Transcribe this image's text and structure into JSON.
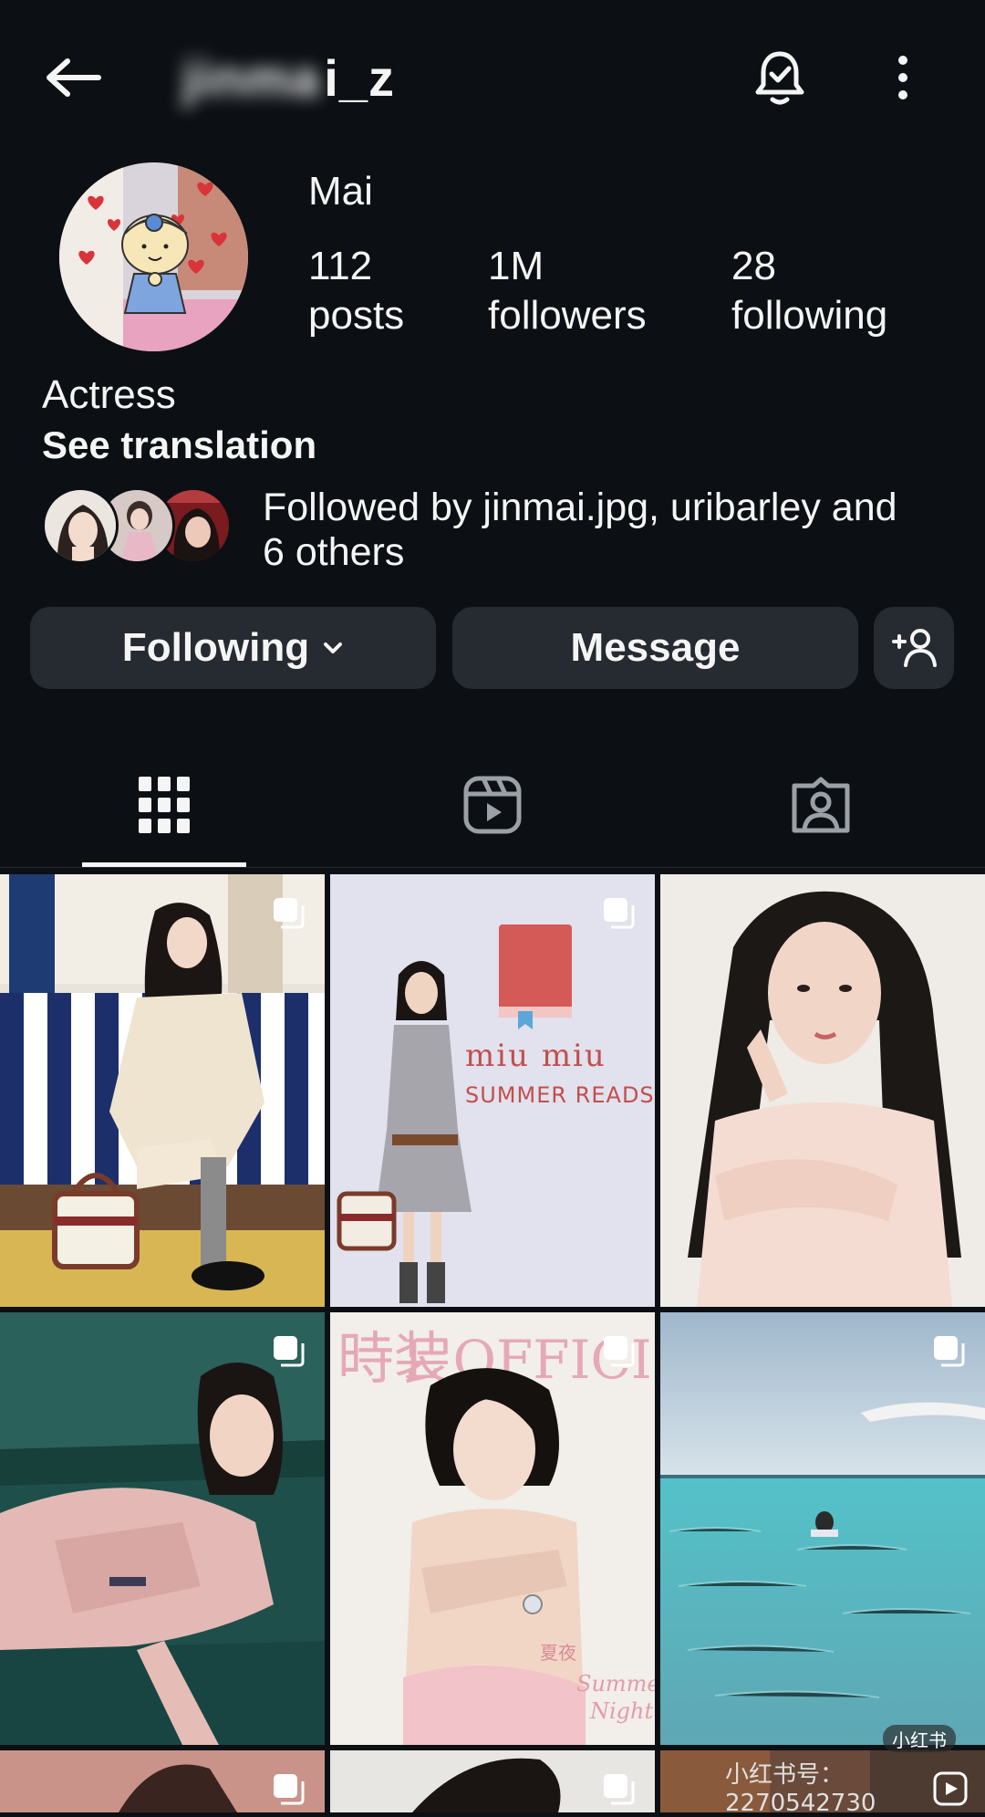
{
  "header": {
    "username_hidden": "j",
    "username_visible": "i_z",
    "back_icon": "arrow-left-icon",
    "bell_icon": "bell-check-icon",
    "more_icon": "more-vertical-icon"
  },
  "profile": {
    "display_name": "Mai",
    "stats": [
      {
        "value": "112",
        "label": "posts"
      },
      {
        "value": "1M",
        "label": "followers"
      },
      {
        "value": "28",
        "label": "following"
      }
    ],
    "bio": "Actress",
    "see_translation": "See translation",
    "mutuals_line1": "Followed by jinmai.jpg, uribarley and",
    "mutuals_line2": "6 others"
  },
  "actions": {
    "following_label": "Following",
    "message_label": "Message",
    "add_user_icon": "add-person-icon"
  },
  "tabs": [
    {
      "name": "grid",
      "icon": "grid-icon",
      "active": true
    },
    {
      "name": "reels",
      "icon": "reels-icon",
      "active": false
    },
    {
      "name": "tagged",
      "icon": "tagged-icon",
      "active": false
    }
  ],
  "grid_text": {
    "post2_brand": "miu miu",
    "post2_subtitle": "SUMMER READS",
    "post5_masthead": "L'OFFICIEL",
    "post5_cn": "時装",
    "post5_cover_cn": "夏夜",
    "post5_cover_en1": "Summer",
    "post5_cover_en2": "Night"
  },
  "watermark": {
    "text": "小红书号：2270542730",
    "badge": "小红书"
  },
  "colors": {
    "background": "#0c1014",
    "button": "#262b32",
    "text": "#f5f5f5"
  }
}
